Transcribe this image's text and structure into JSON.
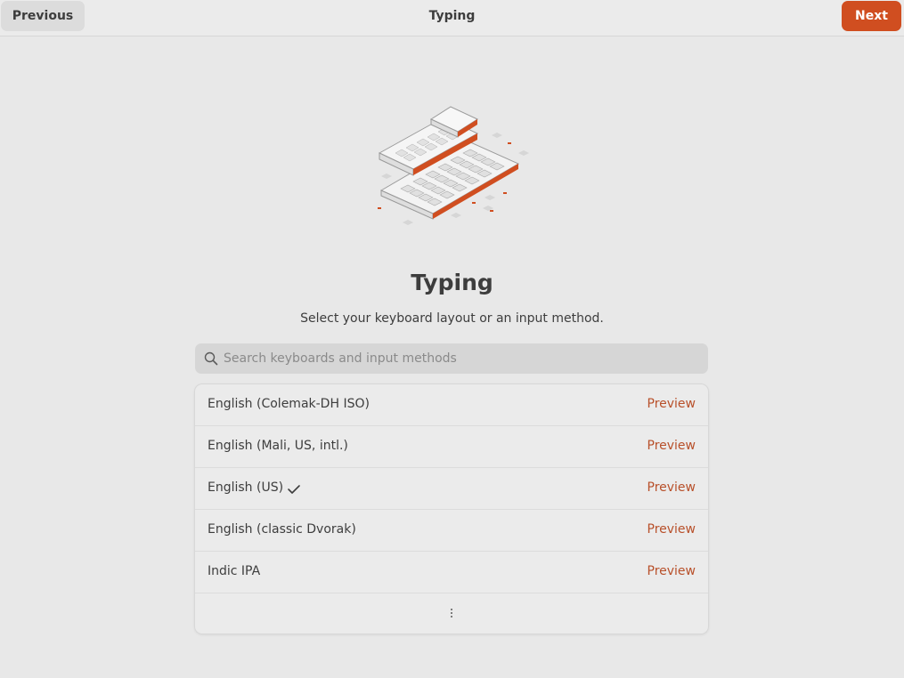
{
  "header": {
    "previous_label": "Previous",
    "title": "Typing",
    "next_label": "Next",
    "accent_color": "#d04e20"
  },
  "main": {
    "illustration_icon": "keyboard-illustration",
    "title": "Typing",
    "subtitle": "Select your keyboard layout or an input method."
  },
  "search": {
    "placeholder": "Search keyboards and input methods",
    "value": "",
    "icon": "search-icon"
  },
  "layouts": {
    "items": [
      {
        "label": "English (Colemak-DH ISO)",
        "preview": "Preview",
        "selected": false
      },
      {
        "label": "English (Mali, US, intl.)",
        "preview": "Preview",
        "selected": false
      },
      {
        "label": "English (US)",
        "preview": "Preview",
        "selected": true
      },
      {
        "label": "English (classic Dvorak)",
        "preview": "Preview",
        "selected": false
      },
      {
        "label": "Indic IPA",
        "preview": "Preview",
        "selected": false
      }
    ],
    "more_icon": "more-vertical-icon"
  }
}
